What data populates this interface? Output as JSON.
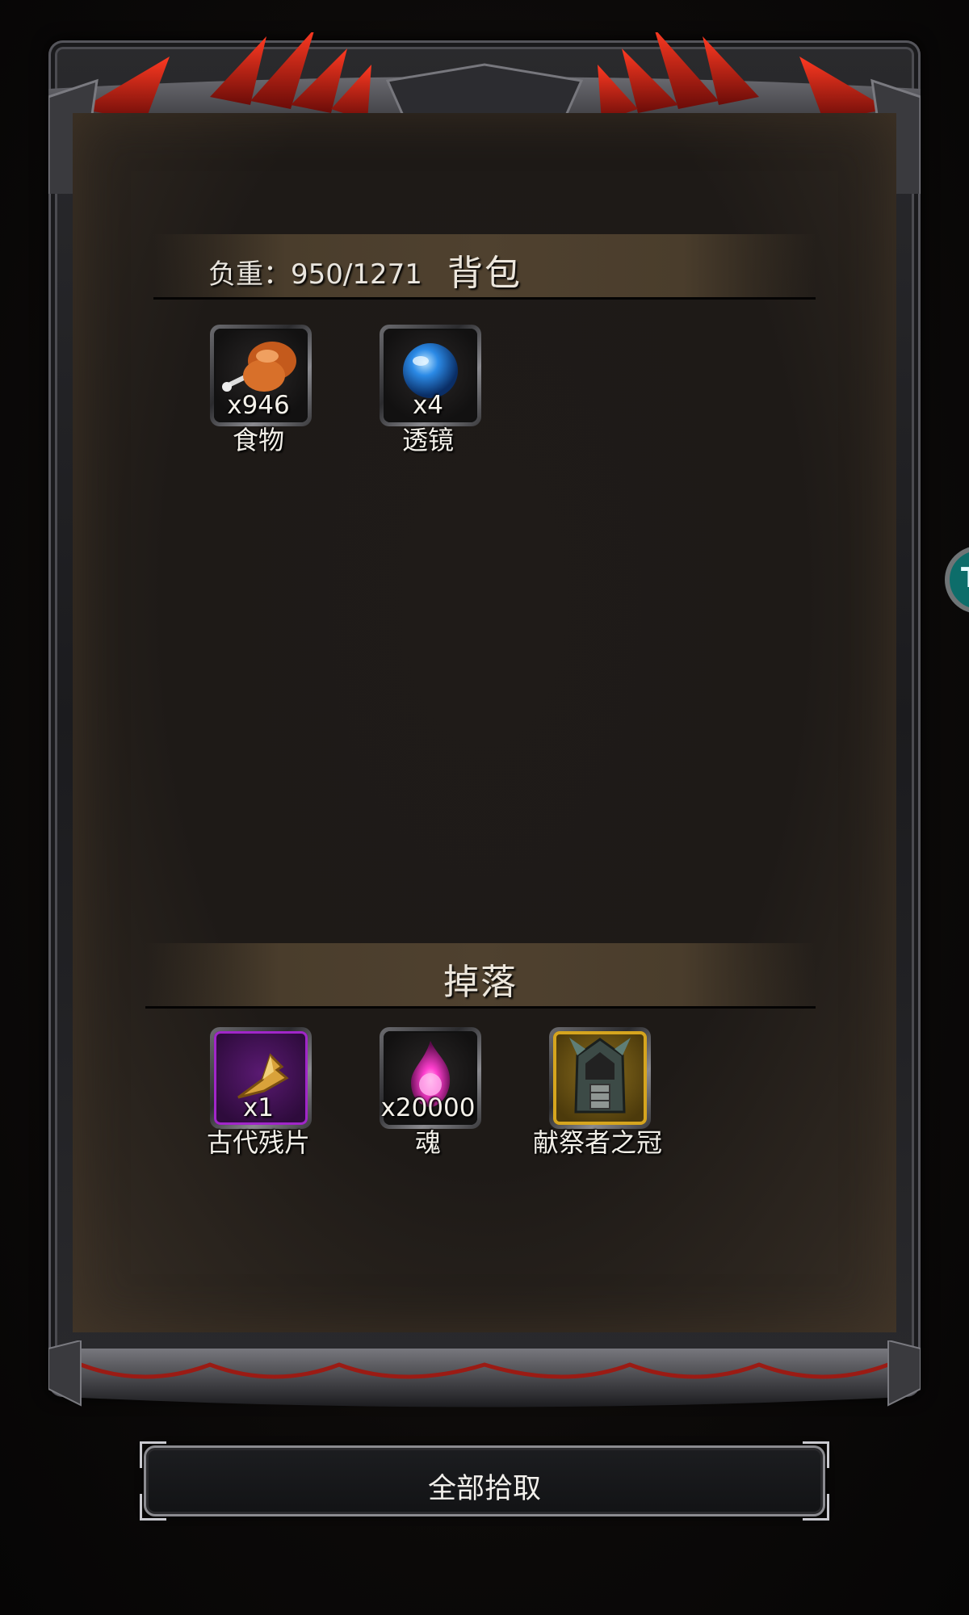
{
  "inventory": {
    "weight_label": "负重：950/1271",
    "title": "背包",
    "items": [
      {
        "name": "食物",
        "qty": "x946",
        "icon": "roast-meat-icon"
      },
      {
        "name": "透镜",
        "qty": "x4",
        "icon": "blue-lens-orb-icon"
      }
    ]
  },
  "drops": {
    "title": "掉落",
    "items": [
      {
        "name": "古代残片",
        "qty": "x1",
        "icon": "ancient-fragment-icon",
        "rarity_color": "#a126c9"
      },
      {
        "name": "魂",
        "qty": "x20000",
        "icon": "pink-soul-flame-icon"
      },
      {
        "name": "献祭者之冠",
        "qty": "",
        "icon": "sacrificer-crown-helmet-icon",
        "rarity_color": "#d6a51e"
      }
    ]
  },
  "actions": {
    "pickup_all_label": "全部拾取"
  },
  "side_badge": {
    "label": "T"
  },
  "colors": {
    "frame_red": "#c4261a",
    "header_bar": "#4f412f",
    "side_badge": "#0d6d6a"
  }
}
